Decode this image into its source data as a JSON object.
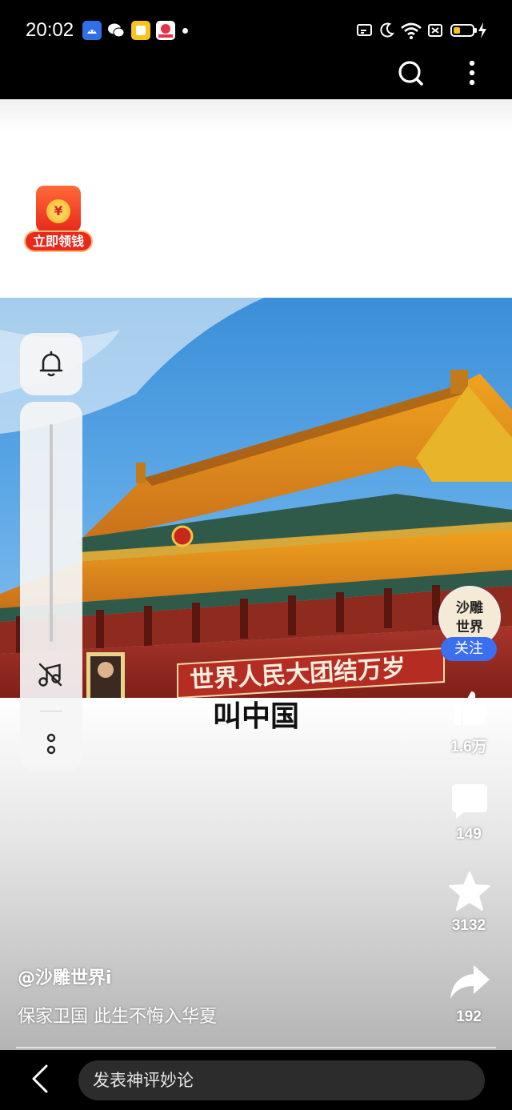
{
  "status_bar": {
    "time": "20:02",
    "notification_icons": [
      "android-icon",
      "wechat-icon",
      "notes-app-icon",
      "shopping-app-icon"
    ]
  },
  "red_packet": {
    "symbol": "¥",
    "label": "立即领钱"
  },
  "video": {
    "banner_text": "世界人民大团结万岁",
    "subtitle": "叫中国"
  },
  "author": {
    "avatar_text": "沙雕世界",
    "follow_label": "关注",
    "handle": "@沙雕世界i",
    "description": "保家卫国 此生不悔入华夏"
  },
  "actions": {
    "likes": "1.6万",
    "comments": "149",
    "favorites": "3132",
    "shares": "192"
  },
  "comment_bar": {
    "placeholder": "发表神评妙论"
  },
  "colors": {
    "follow_blue": "#3b6ff0",
    "red_packet": "#e82a1d",
    "wall_red": "#9e2a22"
  }
}
